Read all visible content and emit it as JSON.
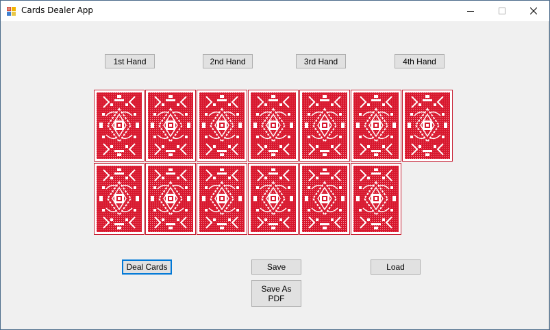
{
  "window": {
    "title": "Cards Dealer App",
    "icon": "app-icon",
    "controls": [
      "minimize-icon",
      "maximize-icon",
      "close-icon"
    ]
  },
  "hands": {
    "first": "1st Hand",
    "second": "2nd Hand",
    "third": "3rd Hand",
    "fourth": "4th Hand"
  },
  "cards": {
    "face": "back",
    "row1_count": 7,
    "row2_count": 6,
    "color": "#d8182e"
  },
  "actions": {
    "deal": "Deal Cards",
    "save": "Save",
    "load": "Load",
    "save_pdf": "Save As\nPDF"
  },
  "colors": {
    "accent": "#0078d7",
    "card_back": "#d8182e",
    "button_face": "#e1e1e1"
  }
}
